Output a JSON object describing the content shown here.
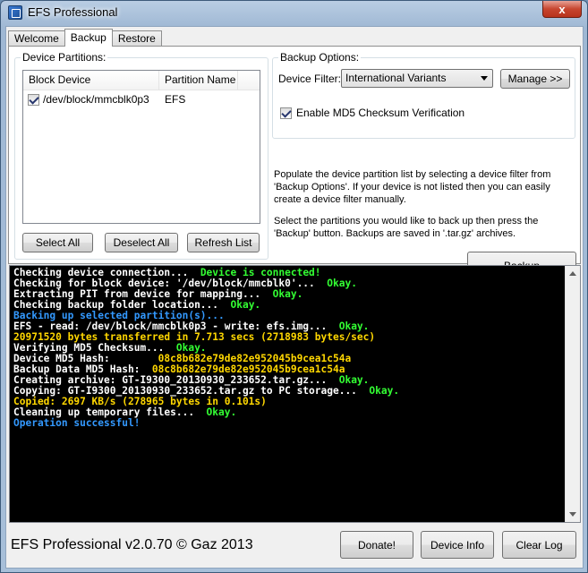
{
  "window": {
    "title": "EFS Professional",
    "close": "x"
  },
  "tabs": [
    {
      "label": "Welcome",
      "active": false
    },
    {
      "label": "Backup",
      "active": true
    },
    {
      "label": "Restore",
      "active": false
    }
  ],
  "partitions": {
    "title": "Device Partitions:",
    "columns": [
      "Block Device",
      "Partition Name"
    ],
    "rows": [
      {
        "checked": true,
        "device": "/dev/block/mmcblk0p3",
        "name": "EFS"
      }
    ],
    "select_all": "Select All",
    "deselect_all": "Deselect All",
    "refresh": "Refresh List"
  },
  "options": {
    "title": "Backup Options:",
    "filter_label": "Device Filter:",
    "filter_value": "International Variants",
    "manage": "Manage >>",
    "md5_label": "Enable MD5 Checksum Verification",
    "md5_checked": true
  },
  "info": {
    "para1": "Populate the device partition list by selecting a device filter from 'Backup Options'. If your device is not listed then you can easily create a device filter manually.",
    "para2": "Select the partitions you would like to back up then press the 'Backup' button. Backups are saved in '.tar.gz' archives."
  },
  "backup_button": "Backup",
  "console": {
    "colors": {
      "white": "#ffffff",
      "green": "#33ff33",
      "yellow": "#ffd700",
      "blue": "#3399ff"
    },
    "lines": [
      [
        {
          "t": "Checking device connection...  ",
          "c": "white"
        },
        {
          "t": "Device is connected!",
          "c": "green"
        }
      ],
      [
        {
          "t": "Checking for block device: '/dev/block/mmcblk0'...  ",
          "c": "white"
        },
        {
          "t": "Okay.",
          "c": "green"
        }
      ],
      [
        {
          "t": "Extracting PIT from device for mapping...  ",
          "c": "white"
        },
        {
          "t": "Okay.",
          "c": "green"
        }
      ],
      [
        {
          "t": "Checking backup folder location...  ",
          "c": "white"
        },
        {
          "t": "Okay.",
          "c": "green"
        }
      ],
      [
        {
          "t": "Backing up selected partition(s)...",
          "c": "blue"
        }
      ],
      [
        {
          "t": "EFS - read: /dev/block/mmcblk0p3 - write: efs.img...  ",
          "c": "white"
        },
        {
          "t": "Okay.",
          "c": "green"
        }
      ],
      [
        {
          "t": "20971520 bytes transferred in 7.713 secs (2718983 bytes/sec)",
          "c": "yellow"
        }
      ],
      [
        {
          "t": "Verifying MD5 Checksum...  ",
          "c": "white"
        },
        {
          "t": "Okay.",
          "c": "green"
        }
      ],
      [
        {
          "t": "Device MD5 Hash:        ",
          "c": "white"
        },
        {
          "t": "08c8b682e79de82e952045b9cea1c54a",
          "c": "yellow"
        }
      ],
      [
        {
          "t": "Backup Data MD5 Hash:  ",
          "c": "white"
        },
        {
          "t": "08c8b682e79de82e952045b9cea1c54a",
          "c": "yellow"
        }
      ],
      [
        {
          "t": "Creating archive: GT-I9300_20130930_233652.tar.gz...  ",
          "c": "white"
        },
        {
          "t": "Okay.",
          "c": "green"
        }
      ],
      [
        {
          "t": "Copying: GT-I9300_20130930_233652.tar.gz to PC storage...  ",
          "c": "white"
        },
        {
          "t": "Okay.",
          "c": "green"
        }
      ],
      [
        {
          "t": "Copied: 2697 KB/s (278965 bytes in 0.101s)",
          "c": "yellow"
        }
      ],
      [
        {
          "t": "Cleaning up temporary files...  ",
          "c": "white"
        },
        {
          "t": "Okay.",
          "c": "green"
        }
      ],
      [
        {
          "t": "Operation successful!",
          "c": "blue"
        }
      ]
    ]
  },
  "footer": {
    "title": "EFS Professional v2.0.70 © Gaz 2013",
    "donate": "Donate!",
    "device_info": "Device Info",
    "clear_log": "Clear Log"
  }
}
